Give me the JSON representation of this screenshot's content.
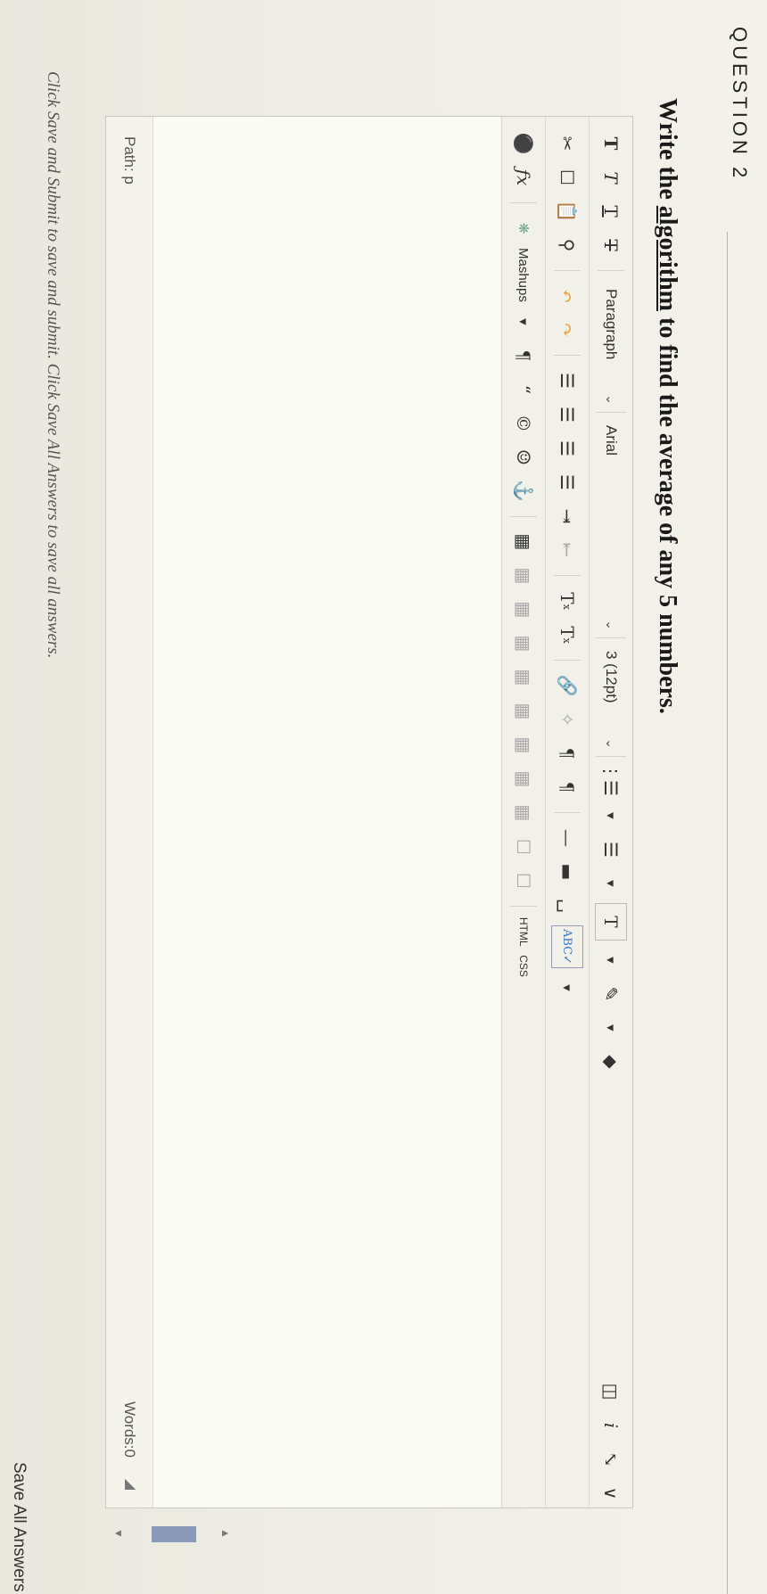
{
  "question": {
    "label": "QUESTION 2",
    "text_before": "Write the ",
    "text_underlined": "algorithm",
    "text_after": "  to find the average of any 5 numbers."
  },
  "toolbar": {
    "row1": {
      "bold": "T",
      "italic": "T",
      "underline": "T",
      "strikethrough": "T",
      "paragraph_select": "Paragraph",
      "font_select": "Arial",
      "size_select": "3 (12pt)",
      "text_color": "T"
    },
    "row2": {
      "superscript": "T",
      "subscript": "T",
      "spellcheck_label": "ABC"
    },
    "row3": {
      "mashups_label": "Mashups",
      "html_label": "HTML",
      "css_label": "CSS"
    }
  },
  "status": {
    "path": "Path: p",
    "words": "Words:0"
  },
  "footer": {
    "instruction": "Click Save and Submit to save and submit. Click Save All Answers to save all answers.",
    "save_all_label": "Save All Answers"
  }
}
